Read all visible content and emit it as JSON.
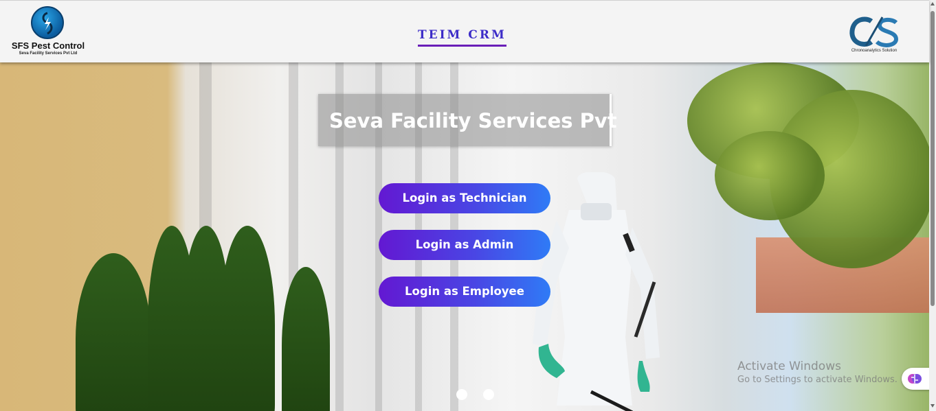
{
  "header": {
    "left_logo": {
      "name": "SFS Pest Control",
      "subtitle": "Seva Facility Services Pvt Ltd",
      "icon": "lightning-circle-icon"
    },
    "title": "TEIM CRM",
    "right_logo": {
      "mark": "CS",
      "subtitle": "Chronoanalytics Solution"
    }
  },
  "hero": {
    "company_name": "Seva Facility Services Pvt",
    "buttons": [
      {
        "label": "Login as Technician"
      },
      {
        "label": "Login as Admin"
      },
      {
        "label": "Login as Employee"
      }
    ],
    "carousel": {
      "slides": 2,
      "active": 1
    }
  },
  "watermark": {
    "line1": "Activate Windows",
    "line2": "Go to Settings to activate Windows."
  },
  "colors": {
    "title": "#3c2cc8",
    "title_underline": "#6a1fb8",
    "button_gradient_start": "#6318d2",
    "button_gradient_end": "#2f7bf6"
  }
}
